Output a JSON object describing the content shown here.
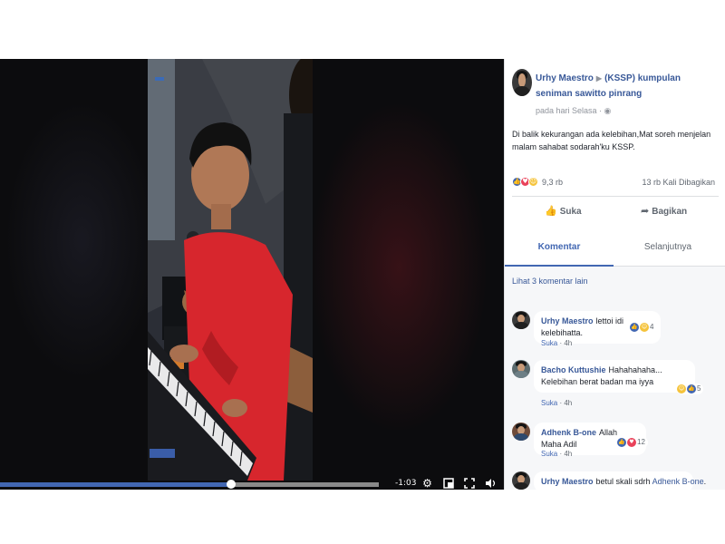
{
  "video": {
    "time": "-1:03",
    "progress": 0.61,
    "controls": {
      "settings_icon": "gear-icon",
      "pip_icon": "picture-in-picture-icon",
      "fullscreen_icon": "fullscreen-icon",
      "volume_icon": "volume-icon"
    }
  },
  "post": {
    "author": "Urhy Maestro",
    "group": "(KSSP) kumpulan seniman sawitto pinrang",
    "time": "pada hari Selasa · ",
    "text": "Di balik kekurangan ada kelebihan,Mat soreh menjelan malam sahabat sodarah'ku KSSP.",
    "reaction_count": "9,3 rb",
    "share_count": "13 rb Kali Dibagikan",
    "reaction_colors": {
      "like": "#4267b2",
      "love": "#e9425a",
      "wow": "#f5c33b"
    }
  },
  "actions": {
    "like_label": "Suka",
    "share_label": "Bagikan"
  },
  "tabs": {
    "comments": "Komentar",
    "next": "Selanjutnya"
  },
  "comments_section": {
    "more_label": "Lihat 3 komentar lain",
    "items": [
      {
        "name": "Urhy Maestro",
        "text": "lettoi idi kelebihatta.",
        "like": "Suka",
        "time": "4h",
        "reactions": "4"
      },
      {
        "name": "Bacho Kuttushie",
        "text": "Hahahahaha... Kelebihan berat badan ma iyya",
        "like": "Suka",
        "time": "4h",
        "reactions": "5"
      },
      {
        "name": "Adhenk B-one",
        "text": "Allah Maha Adil",
        "like": "Suka",
        "time": "4h",
        "reactions": "12"
      },
      {
        "name": "Urhy Maestro",
        "text": "betul skali sdrh",
        "mention": "Adhenk B-one",
        "text_end": "."
      }
    ]
  }
}
